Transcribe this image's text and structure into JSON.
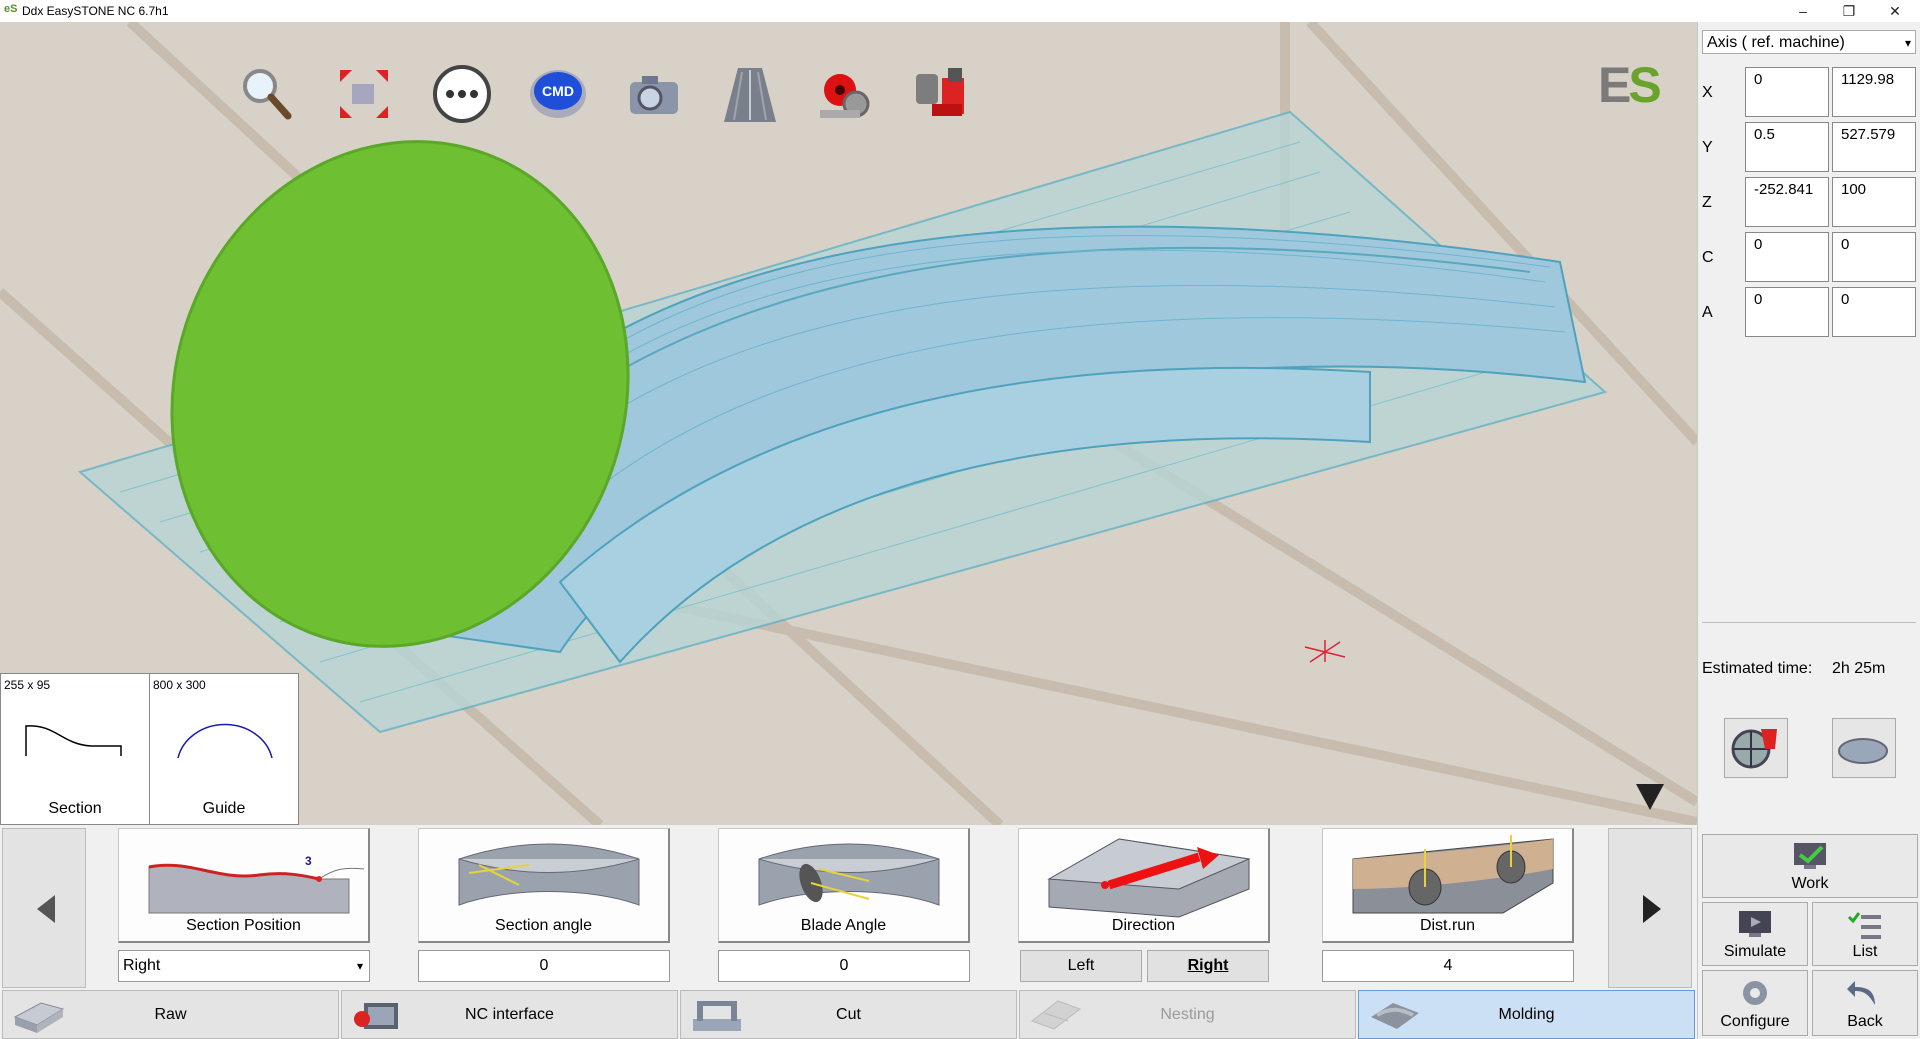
{
  "window": {
    "app_icon": "eS",
    "title": "Ddx EasySTONE NC 6.7h1",
    "buttons": [
      "–",
      "❐",
      "✕"
    ]
  },
  "viewport": {
    "logo": {
      "e": "E",
      "s": "S"
    },
    "toolbar_icons": [
      "zoom-icon",
      "fit-view-icon",
      "more-options-icon",
      "cmd-icon",
      "camera-icon",
      "road-icon",
      "disc-machine-icon",
      "blade-gear-icon"
    ],
    "cmd_label": "CMD",
    "thumbnails": [
      {
        "dim": "255 x 95",
        "label": "Section"
      },
      {
        "dim": "800 x 300",
        "label": "Guide"
      }
    ]
  },
  "side_panel": {
    "axis_select": "Axis ( ref. machine)",
    "axes": [
      {
        "name": "X",
        "v1": "0",
        "v2": "1129.98"
      },
      {
        "name": "Y",
        "v1": "0.5",
        "v2": "527.579"
      },
      {
        "name": "Z",
        "v1": "-252.841",
        "v2": "100"
      },
      {
        "name": "C",
        "v1": "0",
        "v2": "0"
      },
      {
        "name": "A",
        "v1": "0",
        "v2": "0"
      }
    ],
    "estimated_label": "Estimated time:",
    "estimated_value": "2h 25m",
    "buttons": {
      "work": "Work",
      "simulate": "Simulate",
      "list": "List",
      "configure": "Configure",
      "back": "Back"
    }
  },
  "params": {
    "section_position": {
      "label": "Section Position",
      "value": "Right"
    },
    "section_angle": {
      "label": "Section angle",
      "value": "0"
    },
    "blade_angle": {
      "label": "Blade Angle",
      "value": "0"
    },
    "direction": {
      "label": "Direction",
      "left": "Left",
      "right": "Right",
      "selected": "Right"
    },
    "dist_run": {
      "label": "Dist.run",
      "value": "4"
    }
  },
  "tabs": [
    {
      "label": "Raw",
      "state": "normal"
    },
    {
      "label": "NC interface",
      "state": "normal"
    },
    {
      "label": "Cut",
      "state": "normal"
    },
    {
      "label": "Nesting",
      "state": "disabled"
    },
    {
      "label": "Molding",
      "state": "active"
    }
  ],
  "colors": {
    "blade": "#6fbf32",
    "mesh": "#4fb0c6",
    "active_tab": "#cce0f5",
    "ground": "#d8d1c8"
  }
}
